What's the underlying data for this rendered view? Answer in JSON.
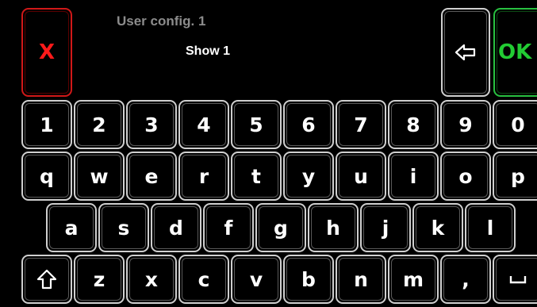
{
  "header": {
    "title": "User config. 1",
    "value": "Show 1",
    "cancel_label": "X",
    "ok_label": "OK",
    "backspace_icon": "backspace-arrow-icon"
  },
  "keyboard": {
    "row_digits": [
      "1",
      "2",
      "3",
      "4",
      "5",
      "6",
      "7",
      "8",
      "9",
      "0"
    ],
    "row_top": [
      "q",
      "w",
      "e",
      "r",
      "t",
      "y",
      "u",
      "i",
      "o",
      "p"
    ],
    "row_middle": [
      "a",
      "s",
      "d",
      "f",
      "g",
      "h",
      "j",
      "k",
      "l"
    ],
    "row_bottom": [
      "z",
      "x",
      "c",
      "v",
      "b",
      "n",
      "m",
      ","
    ],
    "shift_icon": "shift-arrow-icon",
    "space_icon": "space-icon"
  },
  "colors": {
    "background": "#000000",
    "key_border": "#cfcfcf",
    "cancel": "#d01818",
    "ok": "#28c040",
    "title": "#8c8c8c"
  }
}
